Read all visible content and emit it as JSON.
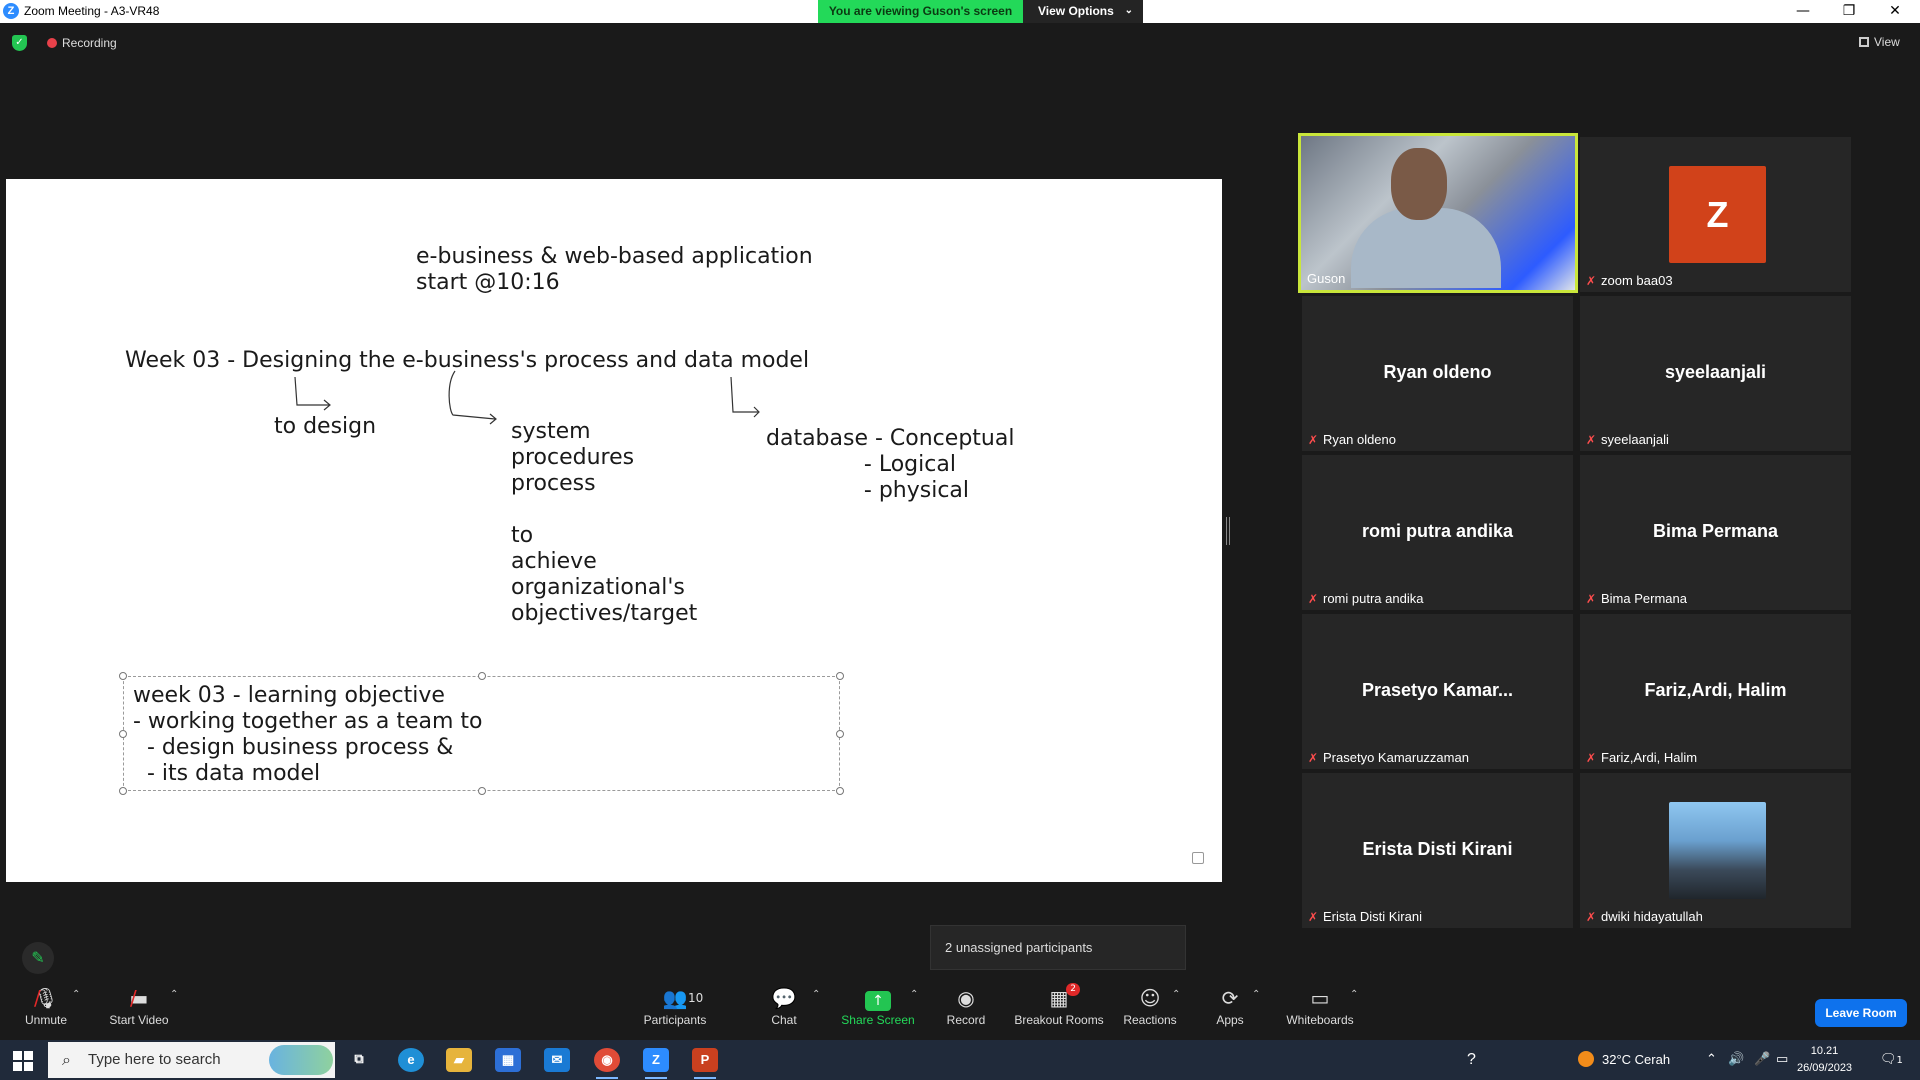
{
  "window": {
    "title": "Zoom Meeting - A3-VR48",
    "viewing_banner": "You are viewing Guson's screen",
    "view_options": "View Options"
  },
  "topbar": {
    "recording": "Recording",
    "view": "View"
  },
  "slide": {
    "heading_line1": "e-business & web-based application",
    "heading_line2": "start @10:16",
    "week_title": "Week 03 - Designing the e-business's process and data model",
    "branch_design": "to design",
    "branch_system": [
      "system",
      "procedures",
      "process",
      "",
      "to",
      "achieve",
      "organizational's",
      "objectives/target"
    ],
    "branch_database": [
      "database - Conceptual",
      "              - Logical",
      "              - physical"
    ],
    "objective": [
      "week 03 - learning objective",
      "- working together as a team to",
      "  - design business process &",
      "  - its data model"
    ]
  },
  "gallery": [
    {
      "name": "Guson",
      "label": "Guson",
      "type": "video",
      "muted": false,
      "active": true
    },
    {
      "name": "Z",
      "label": "zoom baa03",
      "type": "initial",
      "muted": true
    },
    {
      "name": "Ryan oldeno",
      "label": "Ryan oldeno",
      "type": "name",
      "muted": true
    },
    {
      "name": "syeelaanjali",
      "label": "syeelaanjali",
      "type": "name",
      "muted": true
    },
    {
      "name": "romi putra andika",
      "label": "romi putra andika",
      "type": "name",
      "muted": true
    },
    {
      "name": "Bima Permana",
      "label": "Bima Permana",
      "type": "name",
      "muted": true
    },
    {
      "name": "Prasetyo Kamar...",
      "label": "Prasetyo Kamaruzzaman",
      "type": "name",
      "muted": true
    },
    {
      "name": "Fariz,Ardi, Halim",
      "label": "Fariz,Ardi, Halim",
      "type": "name",
      "muted": true
    },
    {
      "name": "Erista Disti Kirani",
      "label": "Erista Disti Kirani",
      "type": "name",
      "muted": true
    },
    {
      "name": "",
      "label": "dwiki hidayatullah",
      "type": "photo",
      "muted": true
    }
  ],
  "unassigned_tooltip": "2 unassigned participants",
  "toolbar": {
    "unmute": "Unmute",
    "start_video": "Start Video",
    "participants": "Participants",
    "participants_count": "10",
    "chat": "Chat",
    "share_screen": "Share Screen",
    "record": "Record",
    "breakout_rooms": "Breakout Rooms",
    "breakout_badge": "2",
    "reactions": "Reactions",
    "apps": "Apps",
    "whiteboards": "Whiteboards",
    "leave_room": "Leave Room"
  },
  "taskbar": {
    "search_placeholder": "Type here to search",
    "weather": "32°C  Cerah",
    "time": "10.21",
    "date": "26/09/2023",
    "notifications": "1"
  },
  "colors": {
    "banner_green": "#23d959",
    "active_speaker": "#c9e63a",
    "leave_blue": "#0e72ed",
    "avatar_orange": "#d1421a"
  }
}
